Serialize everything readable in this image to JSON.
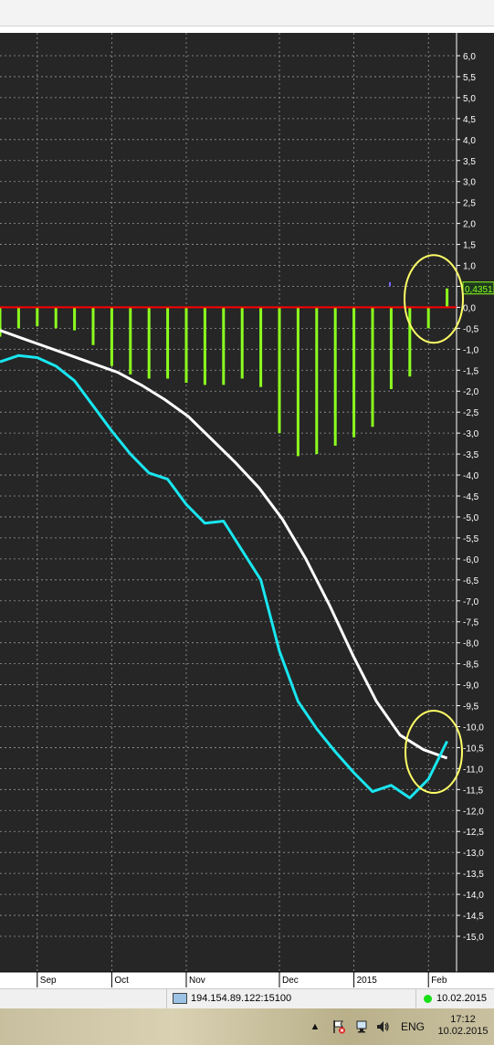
{
  "chart_data": {
    "type": "line",
    "yaxis": {
      "min": -15.0,
      "max": 6.0,
      "step": 0.5,
      "ticks": [
        "6,0",
        "5,5",
        "5,0",
        "4,5",
        "4,0",
        "3,5",
        "3,0",
        "2,5",
        "2,0",
        "1,5",
        "1,0",
        "0,5",
        "0,0",
        "-0,5",
        "-1,0",
        "-1,5",
        "-2,0",
        "-2,5",
        "-3,0",
        "-3,5",
        "-4,0",
        "-4,5",
        "-5,0",
        "-5,5",
        "-6,0",
        "-6,5",
        "-7,0",
        "-7,5",
        "-8,0",
        "-8,5",
        "-9,0",
        "-9,5",
        "-10,0",
        "-10,5",
        "-11,0",
        "-11,5",
        "-12,0",
        "-12,5",
        "-13,0",
        "-13,5",
        "-14,0",
        "-14,5",
        "-15,0"
      ]
    },
    "xaxis": {
      "labels": [
        {
          "text": "Sep",
          "bar": 2
        },
        {
          "text": "Oct",
          "bar": 6
        },
        {
          "text": "Nov",
          "bar": 10
        },
        {
          "text": "Dec",
          "bar": 15
        },
        {
          "text": "2015",
          "bar": 19
        },
        {
          "text": "Feb",
          "bar": 23
        }
      ]
    },
    "zero_line": 0,
    "value_label": "0,4351",
    "histogram": [
      -0.7,
      -0.5,
      -0.45,
      -0.5,
      -0.55,
      -0.9,
      -1.4,
      -1.6,
      -1.7,
      -1.7,
      -1.8,
      -1.85,
      -1.85,
      -1.7,
      -1.9,
      -3.0,
      -3.55,
      -3.5,
      -3.3,
      -3.1,
      -2.85,
      -1.95,
      -1.65,
      -0.5,
      0.45
    ],
    "series": [
      {
        "color": "#ffffff",
        "values": [
          -0.55,
          -0.75,
          -0.95,
          -1.15,
          -1.35,
          -1.55,
          -1.85,
          -2.2,
          -2.6,
          -3.15,
          -3.7,
          -4.3,
          -5.05,
          -6.0,
          -7.1,
          -8.3,
          -9.4,
          -10.2,
          -10.55,
          -10.75
        ]
      },
      {
        "color": "#19e6f0",
        "values": [
          -1.3,
          -1.15,
          -1.2,
          -1.4,
          -1.75,
          -2.35,
          -2.95,
          -3.5,
          -3.95,
          -4.1,
          -4.7,
          -5.15,
          -5.1,
          -5.8,
          -6.5,
          -8.2,
          -9.4,
          -10.05,
          -10.6,
          -11.1,
          -11.55,
          -11.4,
          -11.7,
          -11.25,
          -10.35
        ]
      }
    ],
    "annotations": [
      {
        "shape": "ellipse",
        "color": "#ffff66"
      },
      {
        "shape": "ellipse",
        "color": "#ffff66"
      }
    ],
    "grid": true,
    "colors": {
      "background": "#262626",
      "histogram": "#8cff1e",
      "zero_line": "#ff0000",
      "grid": "#9a9a9a",
      "axis_text": "#ffffff"
    }
  },
  "status_bar": {
    "connection": "194.154.89.122:15100",
    "date": "10.02.2015"
  },
  "taskbar": {
    "language": "ENG",
    "time": "17:12",
    "date": "10.02.2015"
  }
}
